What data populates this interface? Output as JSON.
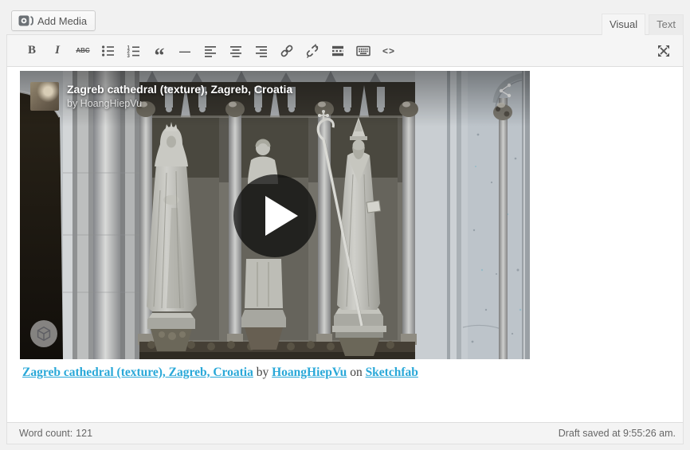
{
  "media_bar": {
    "add_media_label": "Add Media"
  },
  "tabs": {
    "visual": "Visual",
    "text": "Text"
  },
  "toolbar": {
    "buttons": [
      {
        "name": "bold",
        "glyph": "B"
      },
      {
        "name": "italic",
        "glyph": "I"
      },
      {
        "name": "strikethrough",
        "glyph": "ABC"
      },
      {
        "name": "bulleted-list"
      },
      {
        "name": "numbered-list",
        "digits": [
          "1",
          "2",
          "3"
        ]
      },
      {
        "name": "blockquote",
        "glyph": "“"
      },
      {
        "name": "horizontal-rule",
        "glyph": "—"
      },
      {
        "name": "align-left"
      },
      {
        "name": "align-center"
      },
      {
        "name": "align-right"
      },
      {
        "name": "insert-link"
      },
      {
        "name": "remove-link"
      },
      {
        "name": "more-tag"
      },
      {
        "name": "keyboard"
      },
      {
        "name": "code",
        "glyph": "<>"
      }
    ],
    "fullscreen_name": "distraction-free-fullscreen"
  },
  "embed": {
    "title": "Zagreb cathedral (texture), Zagreb, Croatia",
    "byline": "by HoangHiepVu",
    "accent_color": "#1caad9"
  },
  "caption": {
    "link_model": "Zagreb cathedral (texture), Zagreb, Croatia",
    "text_by": " by ",
    "link_author": "HoangHiepVu",
    "text_on": " on ",
    "link_site": "Sketchfab",
    "link_color": "#29a8d8"
  },
  "statusbar": {
    "word_count_label": "Word count:",
    "word_count_value": "121",
    "draft_saved": "Draft saved at 9:55:26 am."
  }
}
